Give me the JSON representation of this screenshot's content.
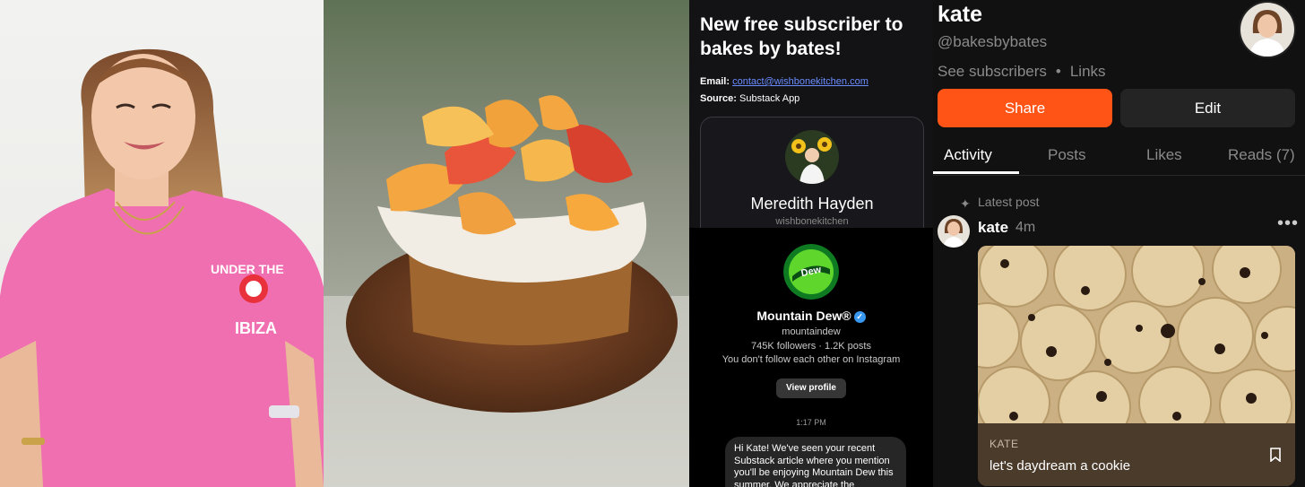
{
  "notification": {
    "title": "New free subscriber to bakes by bates!",
    "email_label": "Email:",
    "email_value": "contact@wishbonekitchen.com",
    "source_label": "Source:",
    "source_value": "Substack App",
    "subscriber_name": "Meredith Hayden",
    "subscriber_handle": "wishbonekitchen"
  },
  "dm": {
    "name": "Mountain Dew®",
    "verified_mark": "✓",
    "handle": "mountaindew",
    "stats": "745K followers · 1.2K posts",
    "follow_status": "You don't follow each other on Instagram",
    "view_profile_label": "View profile",
    "time": "1:17 PM",
    "message": "Hi Kate! We've seen your recent Substack article where you mention you'll be enjoying Mountain Dew this summer. We appreciate the"
  },
  "profile": {
    "name": "kate",
    "handle": "@bakesbybates",
    "see_subscribers": "See subscribers",
    "separator": "•",
    "links": "Links",
    "share_label": "Share",
    "edit_label": "Edit",
    "tabs": [
      {
        "label": "Activity",
        "active": true
      },
      {
        "label": "Posts",
        "active": false
      },
      {
        "label": "Likes",
        "active": false
      },
      {
        "label": "Reads (7)",
        "active": false
      }
    ],
    "latest_post_label": "Latest post",
    "post_author": "kate",
    "post_time": "4m",
    "more_dots": "•••",
    "card_publication": "KATE",
    "card_title": "let's daydream a cookie"
  },
  "colors": {
    "accent": "#ff5416",
    "link": "#6a8cff",
    "verified": "#3897f0"
  },
  "icons": [
    "sparkle-icon",
    "more-icon",
    "bookmark-icon",
    "verified-icon"
  ]
}
